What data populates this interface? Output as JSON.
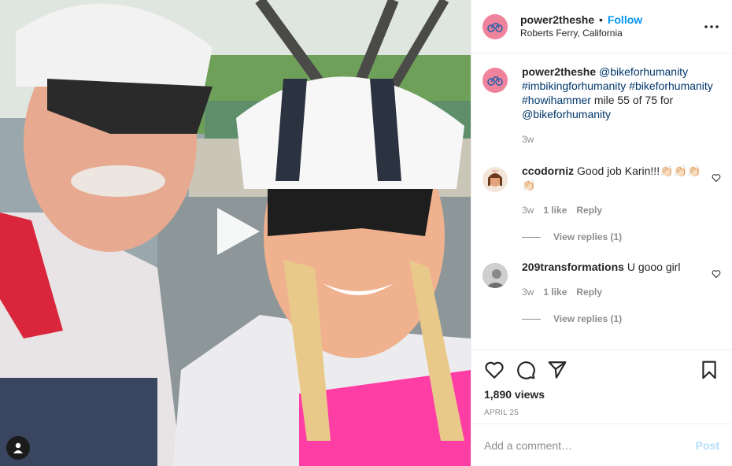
{
  "header": {
    "username": "power2theshe",
    "separator": "•",
    "follow_label": "Follow",
    "location": "Roberts Ferry, California"
  },
  "caption": {
    "username": "power2theshe",
    "parts": [
      {
        "text": "@bikeforhumanity",
        "link": true
      },
      {
        "text": " ",
        "link": false
      },
      {
        "text": "#imbikingforhumanity",
        "link": true
      },
      {
        "text": " ",
        "link": false
      },
      {
        "text": "#bikeforhumanity",
        "link": true
      },
      {
        "text": " ",
        "link": false
      },
      {
        "text": "#howihammer",
        "link": true
      },
      {
        "text": " mile 55 of 75 for ",
        "link": false
      },
      {
        "text": "@bikeforhumanity",
        "link": true
      }
    ],
    "time": "3w"
  },
  "comments": [
    {
      "username": "ccodorniz",
      "text": "Good job Karin!!!👏🏻👏🏻👏🏻👏🏻",
      "time": "3w",
      "likes": "1 like",
      "reply_label": "Reply",
      "view_replies": "View replies (1)"
    },
    {
      "username": "209transformations",
      "text": "U gooo girl",
      "time": "3w",
      "likes": "1 like",
      "reply_label": "Reply",
      "view_replies": "View replies (1)"
    }
  ],
  "stats": {
    "views": "1,890 views",
    "date": "APRIL 25"
  },
  "add_comment": {
    "placeholder": "Add a comment…",
    "post_label": "Post"
  },
  "colors": {
    "link": "#00376b",
    "follow": "#0095f6",
    "muted": "#8e8e8e",
    "post_disabled": "#b2dffc",
    "avatar_brand": "#f0839c"
  },
  "icons": {
    "play": "play-icon",
    "more": "more-options-icon",
    "like": "heart-icon",
    "comment": "comment-icon",
    "share": "share-icon",
    "save": "bookmark-icon",
    "tag": "user-tag-icon"
  }
}
